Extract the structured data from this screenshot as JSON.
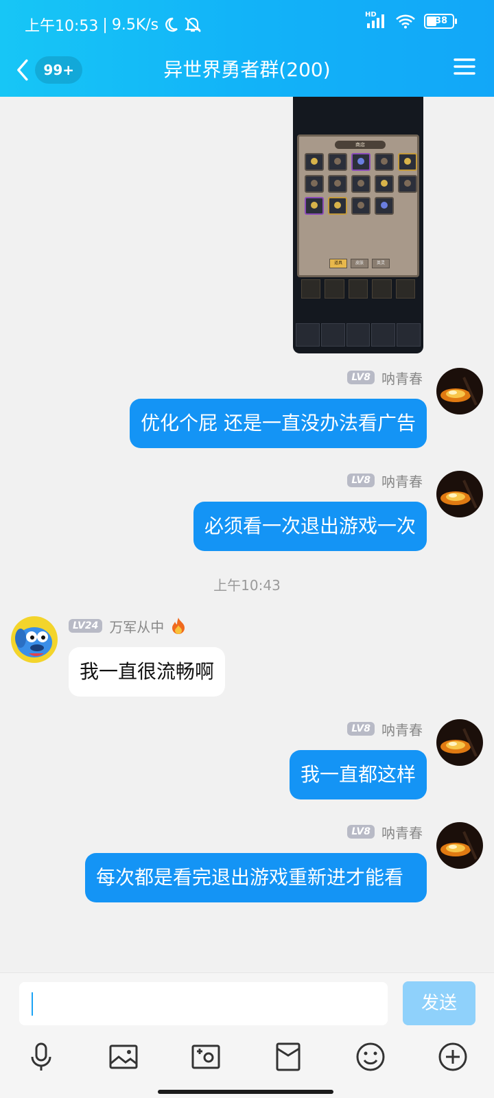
{
  "status_bar": {
    "time": "上午10:53",
    "network_speed": "9.5K/s",
    "signal_label": "HD",
    "battery": "38"
  },
  "header": {
    "unread_count": "99+",
    "title": "异世界勇者群(200)"
  },
  "game_screenshot": {
    "shop_title": "商店",
    "tabs": [
      "道具",
      "皮肤",
      "英灵"
    ]
  },
  "messages": [
    {
      "sender": "呐青春",
      "level": "LV8",
      "text": "优化个屁 还是一直没办法看广告",
      "direction": "out"
    },
    {
      "sender": "呐青春",
      "level": "LV8",
      "text": "必须看一次退出游戏一次",
      "direction": "out"
    },
    {
      "timestamp": "上午10:43"
    },
    {
      "sender": "万军从中",
      "level": "LV24",
      "text": "我一直很流畅啊",
      "direction": "in"
    },
    {
      "sender": "呐青春",
      "level": "LV8",
      "text": "我一直都这样",
      "direction": "out"
    },
    {
      "sender": "呐青春",
      "level": "LV8",
      "text": "每次都是看完退出游戏重新进才能看",
      "direction": "out"
    }
  ],
  "input": {
    "value": "",
    "send_label": "发送"
  },
  "toolbar": [
    "microphone-icon",
    "image-icon",
    "camera-icon",
    "red-packet-icon",
    "emoji-icon",
    "plus-icon"
  ],
  "colors": {
    "header_start": "#17c6f6",
    "header_end": "#12a7f8",
    "out_bubble": "#1494f5",
    "in_bubble": "#ffffff",
    "send_button": "#8fd1fb"
  }
}
